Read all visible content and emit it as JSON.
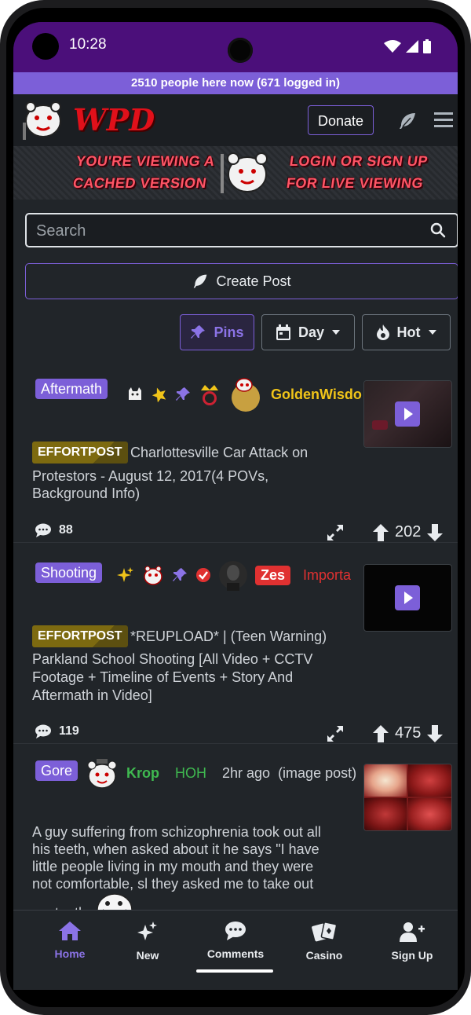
{
  "status_bar": {
    "time": "10:28"
  },
  "online_banner": {
    "text": "2510 people here now (671 logged in)"
  },
  "navbar": {
    "donate_label": "Donate",
    "logo_text": "WPD"
  },
  "cached_banner": {
    "left_line1": "YOU'RE VIEWING A",
    "left_line2": "CACHED VERSION",
    "right_line1": "LOGIN OR SIGN UP",
    "right_line2": "FOR LIVE VIEWING"
  },
  "search": {
    "placeholder": "Search",
    "value": ""
  },
  "create_post": {
    "label": "Create Post"
  },
  "sort": {
    "pins_label": "Pins",
    "day_label": "Day",
    "hot_label": "Hot"
  },
  "posts": [
    {
      "flair": "Aftermath",
      "username": "GoldenWisdo",
      "username_color": "#f0c419",
      "effort_badge": "EFFORTPOST",
      "title_line1": "Charlottesville Car Attack on",
      "title_line2": "Protestors - August 12, 2017(4 POVs,",
      "title_line3": "Background Info)",
      "comments": "88",
      "score": "202"
    },
    {
      "flair": "Shooting",
      "username": "Zes",
      "user_tag": "Importa",
      "effort_badge": "EFFORTPOST",
      "title_line1": "*REUPLOAD* | (Teen Warning)",
      "title_line2": "Parkland School Shooting [All Video + CCTV",
      "title_line3": "Footage + Timeline of Events + Story And",
      "title_line4": "Aftermath in Video]",
      "comments": "119",
      "score": "475"
    },
    {
      "flair": "Gore",
      "username": "Krop",
      "user_tag": "HOH",
      "time": "2hr ago",
      "post_type": "(image post)",
      "title_line1": "A guy suffering from schizophrenia took out all",
      "title_line2": "his teeth, when asked about it he says \"I have",
      "title_line3": "little people living in my mouth and they were",
      "title_line4": "not comfortable, sl they asked me to take out",
      "title_line5": "my teeth"
    }
  ],
  "bottom_nav": {
    "home": "Home",
    "new": "New",
    "comments": "Comments",
    "casino": "Casino",
    "signup": "Sign Up"
  },
  "colors": {
    "accent": "#7c5fd8",
    "status_bar": "#4b0f7a",
    "background": "#212529",
    "gold": "#f0c419",
    "green": "#3fb950",
    "red": "#e03131"
  }
}
